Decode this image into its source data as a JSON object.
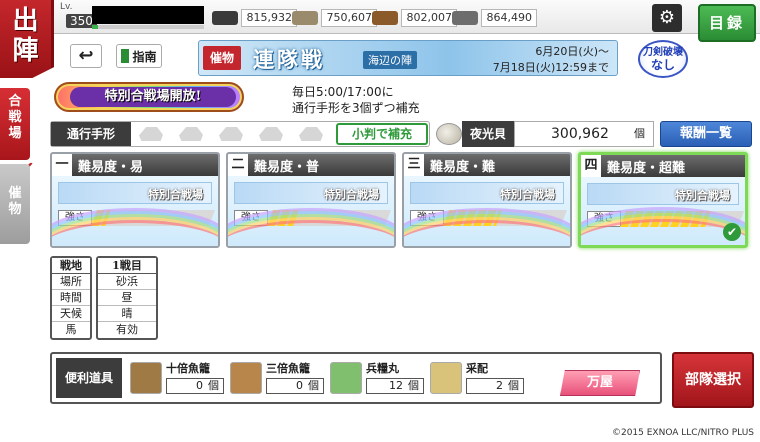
{
  "header": {
    "title_chars": [
      "出",
      "陣"
    ],
    "level_label": "Lv.",
    "level": "350",
    "exp_fraction": 0.05,
    "resources": [
      {
        "name": "charcoal",
        "value": "815,932",
        "color": "#3a3a3a"
      },
      {
        "name": "tamahagane",
        "value": "750,607",
        "color": "#9a8b6c"
      },
      {
        "name": "cooling-material",
        "value": "802,007",
        "color": "#8a5a2b"
      },
      {
        "name": "whetstone",
        "value": "864,490",
        "color": "#6d6d6d"
      }
    ],
    "settings_icon": "gear-icon",
    "catalog_label": "目録"
  },
  "nav": {
    "back_icon": "↩",
    "guide_label": "指南"
  },
  "event_banner": {
    "tag": "催物",
    "title": "連隊戦",
    "subtitle": "海辺の陣",
    "date_start": "6月20日(火)～",
    "date_end": "7月18日(火)12:59まで"
  },
  "sword_badge": {
    "line1": "刀剣破壊",
    "line2": "なし"
  },
  "side_tabs": {
    "battle_chars": [
      "合",
      "戦",
      "場"
    ],
    "event_chars": [
      "催",
      "物"
    ]
  },
  "special_battle": {
    "label": "特別合戦場開放!",
    "info_line1": "毎日5:00/17:00に",
    "info_line2": "通行手形を3個ずつ補充"
  },
  "pass": {
    "label": "通行手形",
    "slots": 6,
    "koban_button": "小判で補充"
  },
  "shell": {
    "label": "夜光貝",
    "value": "300,962",
    "unit": "個"
  },
  "reward_button": "報酬一覧",
  "difficulties": [
    {
      "num": "一",
      "title": "難易度・易",
      "map_label": "特別合戦場",
      "strength_label": "強さ",
      "strength": 0.12,
      "selected": false
    },
    {
      "num": "二",
      "title": "難易度・普",
      "map_label": "特別合戦場",
      "strength_label": "強さ",
      "strength": 0.22,
      "selected": false
    },
    {
      "num": "三",
      "title": "難易度・難",
      "map_label": "特別合戦場",
      "strength_label": "強さ",
      "strength": 0.45,
      "selected": false
    },
    {
      "num": "四",
      "title": "難易度・超難",
      "map_label": "特別合戦場",
      "strength_label": "強さ",
      "strength": 0.72,
      "selected": true
    }
  ],
  "battle_info": {
    "headers": [
      "戦地",
      "場所",
      "時間",
      "天候",
      "馬"
    ],
    "column_title": "1戦目",
    "values": [
      "砂浜",
      "昼",
      "晴",
      "有効"
    ]
  },
  "items": {
    "label": "便利道具",
    "list": [
      {
        "name": "十倍魚籠",
        "count": "0",
        "unit": "個",
        "color": "#a07a45"
      },
      {
        "name": "三倍魚籠",
        "count": "0",
        "unit": "個",
        "color": "#b8864b"
      },
      {
        "name": "兵糧丸",
        "count": "12",
        "unit": "個",
        "color": "#7fbf6e"
      },
      {
        "name": "采配",
        "count": "2",
        "unit": "個",
        "color": "#d9c27a"
      }
    ],
    "shop_button": "万屋"
  },
  "party_button": "部隊選択",
  "footer": "©2015 EXNOA LLC/NITRO PLUS"
}
